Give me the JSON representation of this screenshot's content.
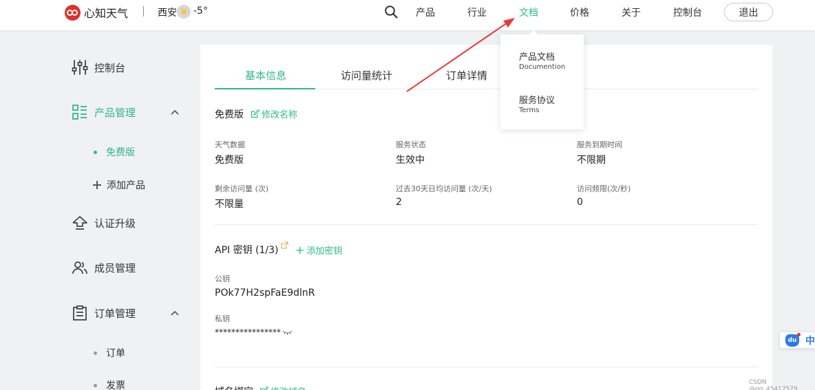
{
  "header": {
    "brand": "心知天气",
    "city": "西安",
    "temperature": "-5°",
    "nav": [
      {
        "label": "产品",
        "active": false
      },
      {
        "label": "行业",
        "active": false
      },
      {
        "label": "文档",
        "active": true
      },
      {
        "label": "价格",
        "active": false
      },
      {
        "label": "关于",
        "active": false
      },
      {
        "label": "控制台",
        "active": false
      }
    ],
    "logout": "退出"
  },
  "docs_dropdown": [
    {
      "title": "产品文档",
      "subtitle": "Documention"
    },
    {
      "title": "服务协议",
      "subtitle": "Terms"
    }
  ],
  "sidebar": {
    "console": "控制台",
    "product_mgmt": "产品管理",
    "free_plan": "免费版",
    "add_product": "添加产品",
    "verify_upgrade": "认证升级",
    "members": "成员管理",
    "orders_mgmt": "订单管理",
    "orders": "订单",
    "invoices": "发票"
  },
  "tabs": [
    {
      "label": "基本信息",
      "active": true
    },
    {
      "label": "访问量统计",
      "active": false
    },
    {
      "label": "订单详情",
      "active": false
    }
  ],
  "plan": {
    "name": "免费版",
    "rename_link": "修改名称",
    "fields": [
      {
        "label": "天气数据",
        "value": "免费版"
      },
      {
        "label": "服务状态",
        "value": "生效中"
      },
      {
        "label": "服务到期时间",
        "value": "不限期"
      },
      {
        "label": "剩余访问量 (次)",
        "value": "不限量"
      },
      {
        "label": "过去30天日均访问量 (次/天)",
        "value": "2"
      },
      {
        "label": "访问频限(次/秒)",
        "value": "0"
      }
    ]
  },
  "api_keys": {
    "heading": "API 密钥 (1/3)",
    "add_link": "添加密钥",
    "public_label": "公钥",
    "public_value": "POk77H2spFaE9dlnR",
    "private_label": "私钥",
    "private_value": "****************"
  },
  "domain_bind": {
    "heading": "域名绑定",
    "edit_link": "修改域名"
  },
  "float_widget": {
    "label": "中"
  },
  "watermark": "CSDN @qq_45417579",
  "colors": {
    "accent": "#2fb98a",
    "brand": "#e0302c",
    "arrow": "#e83a3a"
  }
}
